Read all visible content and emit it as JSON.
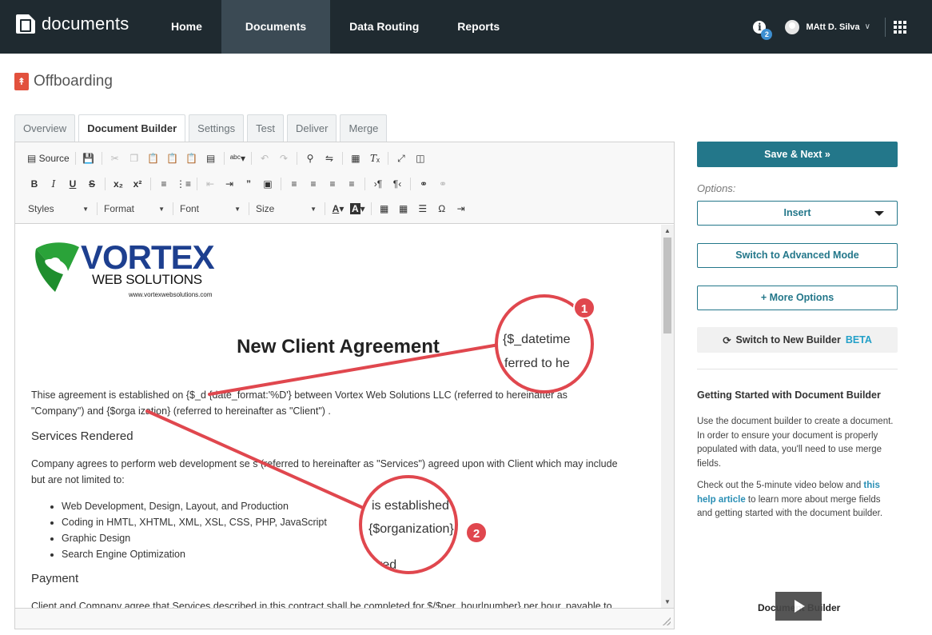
{
  "app": {
    "logo_text": "documents"
  },
  "nav": {
    "links": [
      {
        "label": "Home"
      },
      {
        "label": "Documents"
      },
      {
        "label": "Data Routing"
      },
      {
        "label": "Reports"
      }
    ],
    "info_icon": "info-icon",
    "notification_count": "2",
    "user_name": "MAtt D. Silva",
    "apps_icon": "grid-icon"
  },
  "page": {
    "title": "Offboarding",
    "title_icon": "pdf-icon"
  },
  "tabs": [
    {
      "label": "Overview"
    },
    {
      "label": "Document Builder"
    },
    {
      "label": "Settings"
    },
    {
      "label": "Test"
    },
    {
      "label": "Deliver"
    },
    {
      "label": "Merge"
    }
  ],
  "toolbar": {
    "source_label": "Source",
    "styles_label": "Styles",
    "format_label": "Format",
    "font_label": "Font",
    "size_label": "Size"
  },
  "document": {
    "logo_word": "VORTEX",
    "logo_sub": "WEB SOLUTIONS",
    "logo_url": "www.vortexwebsolutions.com",
    "title": "New Client Agreement",
    "para1_line1": "Thise agreement is established on {$_d          {date_format:'%D'} between Vortex Web Solutions LLC (referred to hereinafter as",
    "para1_line2": "\"Company\") and {$orga   ization} (referred to hereinafter as \"Client\") .",
    "heading_services": "Services Rendered",
    "para2_line1": "Company agrees to perform web development se         s (referred to hereinafter as \"Services\") agreed upon with Client which may include",
    "para2_line2": "but are not limited to:",
    "bullets": [
      "Web Development, Design, Layout, and Production",
      "Coding in HMTL, XHTML, XML, XSL, CSS, PHP, JavaScript",
      "Graphic Design",
      "Search Engine Optimization"
    ],
    "heading_payment": "Payment",
    "para3_line1": "Client and Company agree that Services described in this contract shall be completed for $/$per_hour|number} per hour, payable to"
  },
  "callouts": [
    {
      "number": "1",
      "line1": "{$_datetime",
      "line2": "ferred to he"
    },
    {
      "number": "2",
      "line1": "is established",
      "line2": "{$organization}",
      "line3": "red"
    }
  ],
  "sidebar": {
    "save_next": "Save & Next »",
    "options_label": "Options:",
    "insert_label": "Insert",
    "advanced_label": "Switch to Advanced Mode",
    "more_options_label": "+ More Options",
    "new_builder_label": "Switch to New Builder",
    "beta_label": "BETA",
    "gs_title": "Getting Started with Document Builder",
    "gs_p1": "Use the document builder to create a document. In order to ensure your document is properly populated with data, you'll need to use merge fields.",
    "gs_p2_prefix": "Check out the 5-minute video below and ",
    "gs_p2_link": "this help article",
    "gs_p2_suffix": " to learn more about merge fields and getting started with the document builder.",
    "video_label": "Document Builder"
  },
  "colors": {
    "nav_bg": "#1f2a30",
    "accent": "#23778a",
    "callout": "#e0474e",
    "link": "#2a8fb5"
  }
}
